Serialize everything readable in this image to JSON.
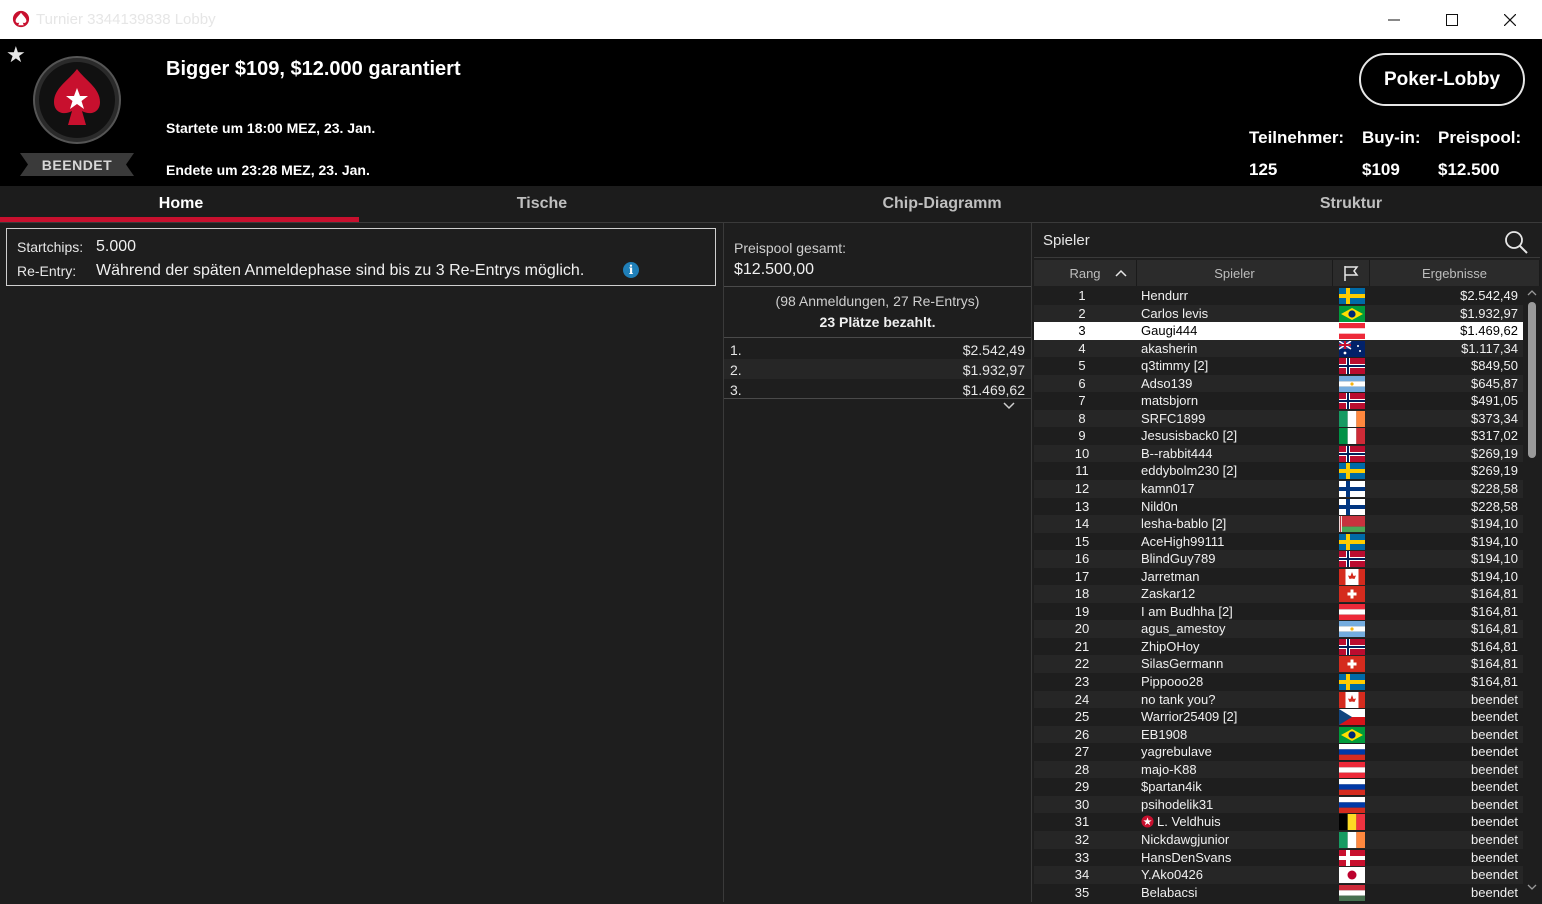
{
  "window": {
    "title": "Turnier 3344139838 Lobby"
  },
  "header": {
    "status": "BEENDET",
    "name": "Bigger $109, $12.000 garantiert",
    "started": "Startete um 18:00 MEZ, 23. Jan.",
    "ended": "Endete um 23:28 MEZ, 23. Jan.",
    "lobby_button": "Poker-Lobby",
    "stats": [
      {
        "label": "Teilnehmer:",
        "value": "125"
      },
      {
        "label": "Buy-in:",
        "value": "$109"
      },
      {
        "label": "Preispool:",
        "value": "$12.500"
      }
    ]
  },
  "tabs": [
    "Home",
    "Tische",
    "Chip-Diagramm",
    "Struktur"
  ],
  "info": {
    "startchips_label": "Startchips:",
    "startchips_value": "5.000",
    "reentry_label": "Re-Entry:",
    "reentry_value": "Während der späten Anmeldephase sind bis zu 3 Re-Entrys möglich."
  },
  "prize": {
    "pool_label": "Preispool gesamt:",
    "pool_value": "$12.500,00",
    "entries": "(98 Anmeldungen, 27 Re-Entrys)",
    "paid": "23 Plätze bezahlt.",
    "payouts": [
      {
        "place": "1.",
        "amount": "$2.542,49"
      },
      {
        "place": "2.",
        "amount": "$1.932,97"
      },
      {
        "place": "3.",
        "amount": "$1.469,62"
      }
    ]
  },
  "players": {
    "search_label": "Spieler",
    "columns": {
      "rank": "Rang",
      "player": "Spieler",
      "result": "Ergebnisse"
    },
    "selected_rank": "3",
    "rows": [
      {
        "rank": "1",
        "name": "Hendurr",
        "flag": "se",
        "result": "$2.542,49"
      },
      {
        "rank": "2",
        "name": "Carlos levis",
        "flag": "br",
        "result": "$1.932,97"
      },
      {
        "rank": "3",
        "name": "Gaugi444",
        "flag": "at",
        "result": "$1.469,62"
      },
      {
        "rank": "4",
        "name": "akasherin",
        "flag": "au",
        "result": "$1.117,34"
      },
      {
        "rank": "5",
        "name": "q3timmy [2]",
        "flag": "no",
        "result": "$849,50"
      },
      {
        "rank": "6",
        "name": "Adso139",
        "flag": "ar",
        "result": "$645,87"
      },
      {
        "rank": "7",
        "name": "matsbjorn",
        "flag": "no",
        "result": "$491,05"
      },
      {
        "rank": "8",
        "name": "SRFC1899",
        "flag": "ie",
        "result": "$373,34"
      },
      {
        "rank": "9",
        "name": "Jesusisback0 [2]",
        "flag": "it",
        "result": "$317,02"
      },
      {
        "rank": "10",
        "name": "B--rabbit444",
        "flag": "no",
        "result": "$269,19"
      },
      {
        "rank": "11",
        "name": "eddybolm230 [2]",
        "flag": "se",
        "result": "$269,19"
      },
      {
        "rank": "12",
        "name": "kamn017",
        "flag": "fi",
        "result": "$228,58"
      },
      {
        "rank": "13",
        "name": "Nild0n",
        "flag": "fi",
        "result": "$228,58"
      },
      {
        "rank": "14",
        "name": "lesha-bablo [2]",
        "flag": "by",
        "result": "$194,10"
      },
      {
        "rank": "15",
        "name": "AceHigh99111",
        "flag": "se",
        "result": "$194,10"
      },
      {
        "rank": "16",
        "name": "BlindGuy789",
        "flag": "no",
        "result": "$194,10"
      },
      {
        "rank": "17",
        "name": "Jarretman",
        "flag": "ca",
        "result": "$194,10"
      },
      {
        "rank": "18",
        "name": "Zaskar12",
        "flag": "ch",
        "result": "$164,81"
      },
      {
        "rank": "19",
        "name": "I am Budhha [2]",
        "flag": "at",
        "result": "$164,81"
      },
      {
        "rank": "20",
        "name": "agus_amestoy",
        "flag": "ar",
        "result": "$164,81"
      },
      {
        "rank": "21",
        "name": "ZhipOHoy",
        "flag": "no",
        "result": "$164,81"
      },
      {
        "rank": "22",
        "name": "SilasGermann",
        "flag": "ch",
        "result": "$164,81"
      },
      {
        "rank": "23",
        "name": "Pippooo28",
        "flag": "se",
        "result": "$164,81"
      },
      {
        "rank": "24",
        "name": "no tank you?",
        "flag": "ca",
        "result": "beendet"
      },
      {
        "rank": "25",
        "name": "Warrior25409 [2]",
        "flag": "cz",
        "result": "beendet"
      },
      {
        "rank": "26",
        "name": "EB1908",
        "flag": "br",
        "result": "beendet"
      },
      {
        "rank": "27",
        "name": "yagrebulave",
        "flag": "ru",
        "result": "beendet"
      },
      {
        "rank": "28",
        "name": "majo-K88",
        "flag": "at",
        "result": "beendet"
      },
      {
        "rank": "29",
        "name": "$partan4ik",
        "flag": "ru",
        "result": "beendet"
      },
      {
        "rank": "30",
        "name": "psihodelik31",
        "flag": "ru",
        "result": "beendet"
      },
      {
        "rank": "31",
        "name": "L. Veldhuis",
        "flag": "be",
        "result": "beendet",
        "star": true
      },
      {
        "rank": "32",
        "name": "Nickdawgjunior",
        "flag": "ie",
        "result": "beendet"
      },
      {
        "rank": "33",
        "name": "HansDenSvans",
        "flag": "dk",
        "result": "beendet"
      },
      {
        "rank": "34",
        "name": "Y.Ako0426",
        "flag": "jp",
        "result": "beendet"
      },
      {
        "rank": "35",
        "name": "Belabacsi",
        "flag": "hu",
        "result": "beendet"
      }
    ]
  },
  "colors": {
    "accent": "#c8102e",
    "header_bg": "#000000",
    "panel_bg": "#1e1e1e",
    "info_icon": "#1f7fb8"
  }
}
